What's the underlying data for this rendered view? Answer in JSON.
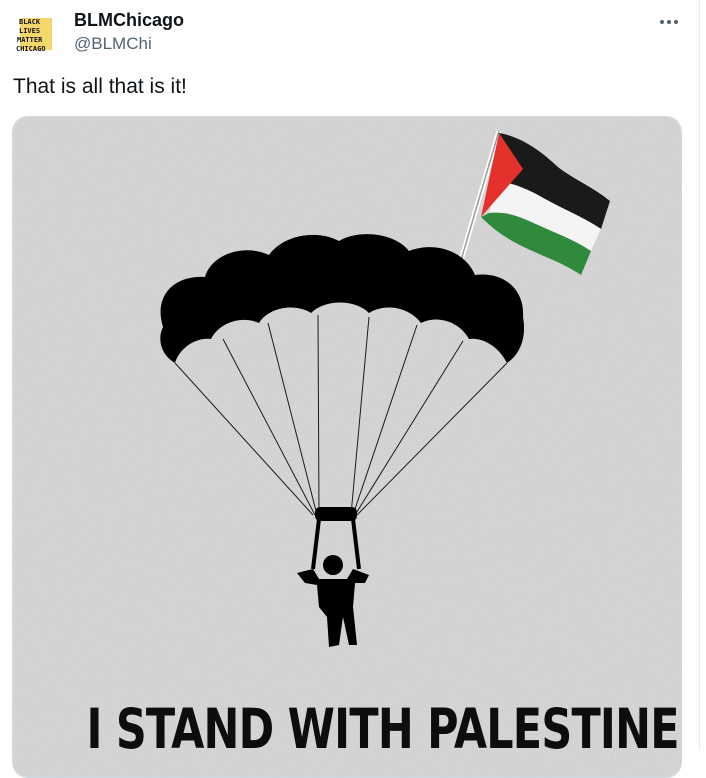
{
  "author": {
    "display_name": "BLMChicago",
    "handle": "@BLMChi",
    "avatar_text": [
      "BLACK",
      "LIVES",
      "MATTER",
      "CHICAGO"
    ]
  },
  "menu": {
    "icon": "more-horizontal-icon"
  },
  "tweet": {
    "text": "That is all that is it!"
  },
  "media": {
    "caption": "I STAND WITH PALESTINE.",
    "flag_colors": {
      "red": "#e4312b",
      "black": "#1a1a1a",
      "white": "#f4f4f4",
      "green": "#2f8a3c"
    }
  },
  "colors": {
    "text": "#0f1419",
    "secondary": "#536471",
    "border": "#cfd9de"
  }
}
